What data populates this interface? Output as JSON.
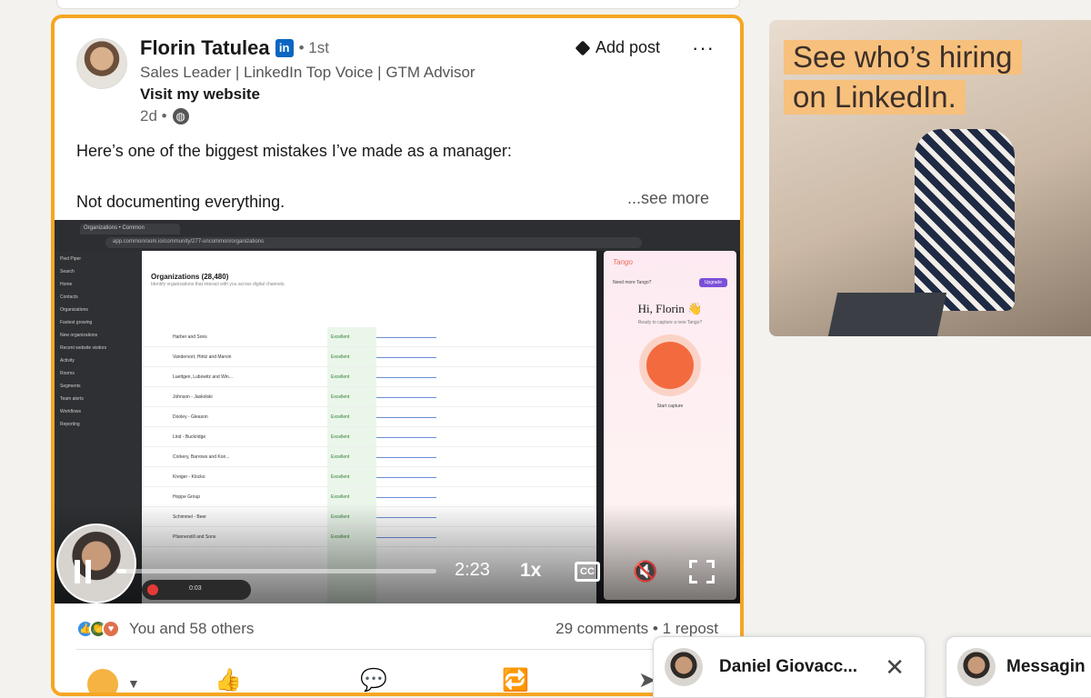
{
  "post": {
    "author_name": "Florin Tatulea",
    "linkedin_badge": "in",
    "degree": "• 1st",
    "headline": "Sales Leader | LinkedIn Top Voice | GTM Advisor",
    "website_link": "Visit my website",
    "time": "2d •",
    "visibility_icon": "globe-icon",
    "add_post_label": "Add post",
    "more_label": "···",
    "text_line1": "Here’s one of the biggest mistakes I’ve made as a manager:",
    "text_line2": "Not documenting everything.",
    "see_more": "...see more"
  },
  "video": {
    "time": "2:23",
    "speed": "1x",
    "cc_label": "CC",
    "progress": 0.03,
    "recording_time": "0:03",
    "screen": {
      "url": "app.commonroom.io/community/277-uncommon/organizations",
      "tab_title": "Organizations • Common",
      "workspace": "Pied Piper",
      "page_title": "Organizations (28,480)",
      "page_subtitle": "Identify organizations that interact with you across digital channels.",
      "sidebar": [
        "Search",
        "Home",
        "Contacts",
        "Organizations",
        "Fastest growing",
        "New organizations",
        "Recent website visitors",
        "Activity",
        "Rooms",
        "Segments",
        "Team alerts",
        "Workflows",
        "Reporting"
      ],
      "rows": [
        "Harber and Sons",
        "Vandervort, Hintz and Marvin",
        "Luettgen, Lubowitz and Win...",
        "Johnson - Jaskolski",
        "Dooley - Gleason",
        "Lind - Buckridge",
        "Corkery, Barrows and Kon...",
        "Kreiger - Klocko",
        "Hoppe Group",
        "Schimmel - Beer",
        "Pfannerstill and Sons"
      ],
      "score": "Excellent",
      "tango": {
        "brand": "Tango",
        "need_more": "Need more Tango?",
        "upgrade": "Upgrade",
        "greeting": "Hi, Florin 👋",
        "ready": "Ready to capture a new Tango?",
        "start": "Start capture"
      }
    }
  },
  "social": {
    "reactions_text": "You and 58 others",
    "counts": "29 comments • 1 repost"
  },
  "ad": {
    "line1": "See who’s hiring",
    "line2": "on LinkedIn."
  },
  "messaging": {
    "chat_name": "Daniel Giovacc...",
    "close_label": "✕",
    "panel_label": "Messagin"
  }
}
